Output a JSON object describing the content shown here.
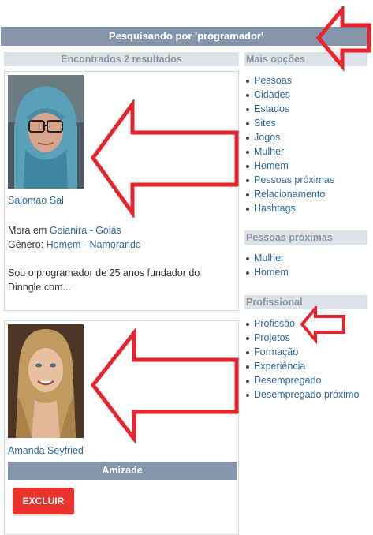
{
  "page": {
    "title": "Pesquisando por 'programador'"
  },
  "results": {
    "header": "Encontrados 2 resultados",
    "items": [
      {
        "name": "Salomao Sal",
        "mora_label": "Mora em",
        "city": "Goianira",
        "sep1": " - ",
        "state": "Goiás",
        "genero_label": "Gênero:",
        "gender": "Homem",
        "sep2": " - ",
        "relationship": "Namorando",
        "bio": "Sou o programador de 25 anos fundador do Dinngle.com..."
      },
      {
        "name": "Amanda Seyfried",
        "amizade_label": "Amizade",
        "excluir_label": "EXCLUIR"
      }
    ]
  },
  "sidebar": {
    "mais_opcoes": {
      "title": "Mais opções",
      "items": [
        "Pessoas",
        "Cidades",
        "Estados",
        "Sites",
        "Jogos",
        "Mulher",
        "Homem",
        "Pessoas próximas",
        "Relacionamento",
        "Hashtags"
      ]
    },
    "pessoas_proximas": {
      "title": "Pessoas próximas",
      "items": [
        "Mulher",
        "Homem"
      ]
    },
    "profissional": {
      "title": "Profissional",
      "items": [
        "Profissão",
        "Projetos",
        "Formação",
        "Experiência",
        "Desempregado",
        "Desempregado próximo"
      ]
    }
  },
  "colors": {
    "header_bar": "#8496ac",
    "link": "#2e6aa1",
    "section_header_bg": "#dde2e8",
    "excluir_button": "#e8342c",
    "annotation_arrow": "#e8232b"
  }
}
